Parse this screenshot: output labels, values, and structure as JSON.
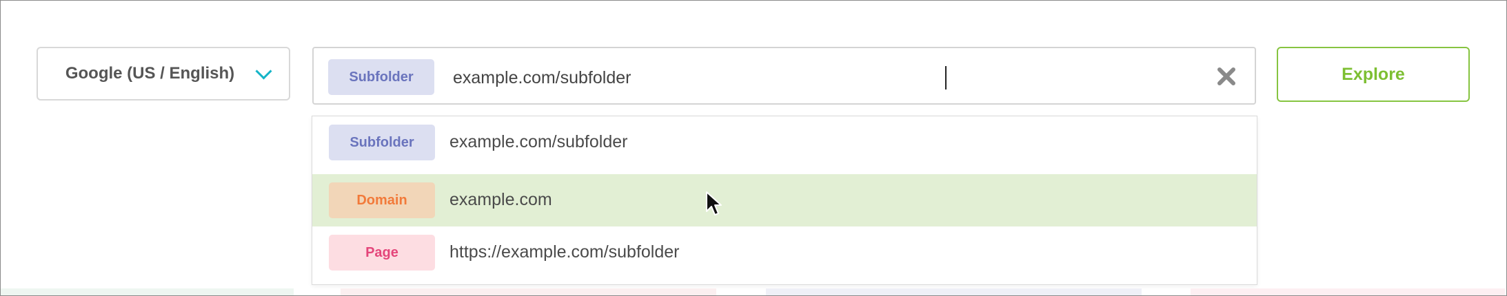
{
  "engine": {
    "label": "Google (US / English)"
  },
  "search": {
    "tag": "Subfolder",
    "value": "example.com/subfolder"
  },
  "explore": {
    "label": "Explore"
  },
  "suggestions": [
    {
      "tag": "Subfolder",
      "text": "example.com/subfolder"
    },
    {
      "tag": "Domain",
      "text": "example.com"
    },
    {
      "tag": "Page",
      "text": "https://example.com/subfolder"
    }
  ],
  "colors": {
    "accent_teal": "#14b4c7",
    "explore_green": "#7dbf32",
    "highlight_row": "#e2efd4",
    "subfolder_tag_bg": "#dcdff1",
    "domain_tag_bg": "#f2d6b8",
    "page_tag_bg": "#fddde2"
  },
  "icons": {
    "dropdown": "chevron-down-icon",
    "clear": "close-icon",
    "pointer": "mouse-cursor-icon"
  }
}
